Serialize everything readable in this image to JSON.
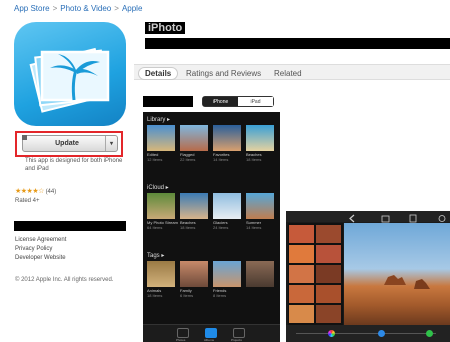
{
  "breadcrumb": {
    "item1": "App Store",
    "item2": "Photo & Video",
    "item3": "Apple",
    "sep": ">"
  },
  "app": {
    "title": "iPhoto"
  },
  "update_button": {
    "label": "Update",
    "arrow": "▾"
  },
  "device_note": "This app is designed for both iPhone and iPad",
  "rating": {
    "stars": "★★★★☆",
    "count": "(44)",
    "rated": "Rated 4+"
  },
  "links": [
    "License Agreement",
    "Privacy Policy",
    "Developer Website"
  ],
  "copyright": "© 2012 Apple Inc. All rights reserved.",
  "tabs": [
    "Details",
    "Ratings and Reviews",
    "Related"
  ],
  "device_toggle": {
    "iphone": "iPhone",
    "ipad": "iPad"
  },
  "phone": {
    "library": {
      "label": "Library ▸",
      "items": [
        {
          "name": "Edited",
          "count": "12 Items"
        },
        {
          "name": "Flagged",
          "count": "22 Items"
        },
        {
          "name": "Favorites",
          "count": "14 Items"
        },
        {
          "name": "Beaches",
          "count": "18 Items"
        }
      ]
    },
    "icloud": {
      "label": "iCloud ▸",
      "items": [
        {
          "name": "My Photo Stream",
          "count": "64 Items"
        },
        {
          "name": "Beaches",
          "count": "18 Items"
        },
        {
          "name": "Glaciers",
          "count": "24 Items"
        },
        {
          "name": "Summer",
          "count": "14 Items"
        }
      ]
    },
    "tags": {
      "label": "Tags ▸",
      "items": [
        {
          "name": "Animals",
          "count": "18 Items"
        },
        {
          "name": "Family",
          "count": "6 Items"
        },
        {
          "name": "Friends",
          "count": "8 Items"
        },
        {
          "name": "",
          "count": ""
        }
      ]
    },
    "tabbar": [
      "Photos",
      "Albums",
      "Projects"
    ]
  },
  "colors": {
    "link": "#2a6fb8",
    "highlight": "#e3262a",
    "accent": "#1f8be8"
  }
}
